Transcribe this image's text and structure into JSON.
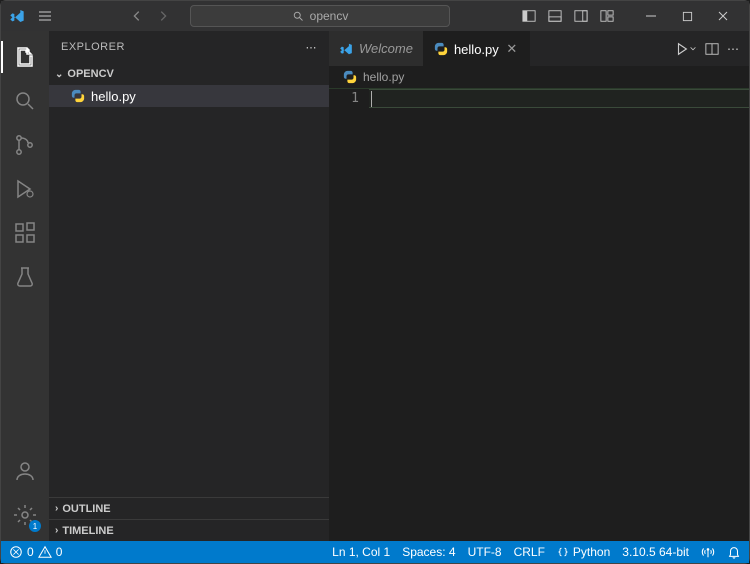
{
  "titlebar": {
    "search_placeholder": "opencv"
  },
  "sidebar": {
    "title": "EXPLORER",
    "folder": "OPENCV",
    "files": [
      {
        "name": "hello.py"
      }
    ],
    "outline": "OUTLINE",
    "timeline": "TIMELINE"
  },
  "tabs": [
    {
      "label": "Welcome",
      "active": false,
      "closable": false
    },
    {
      "label": "hello.py",
      "active": true,
      "closable": true
    }
  ],
  "breadcrumb": {
    "file": "hello.py"
  },
  "editor": {
    "line_number": "1"
  },
  "statusbar": {
    "errors": "0",
    "warnings": "0",
    "position": "Ln 1, Col 1",
    "spaces": "Spaces: 4",
    "encoding": "UTF-8",
    "eol": "CRLF",
    "language": "Python",
    "interpreter": "3.10.5 64-bit"
  }
}
